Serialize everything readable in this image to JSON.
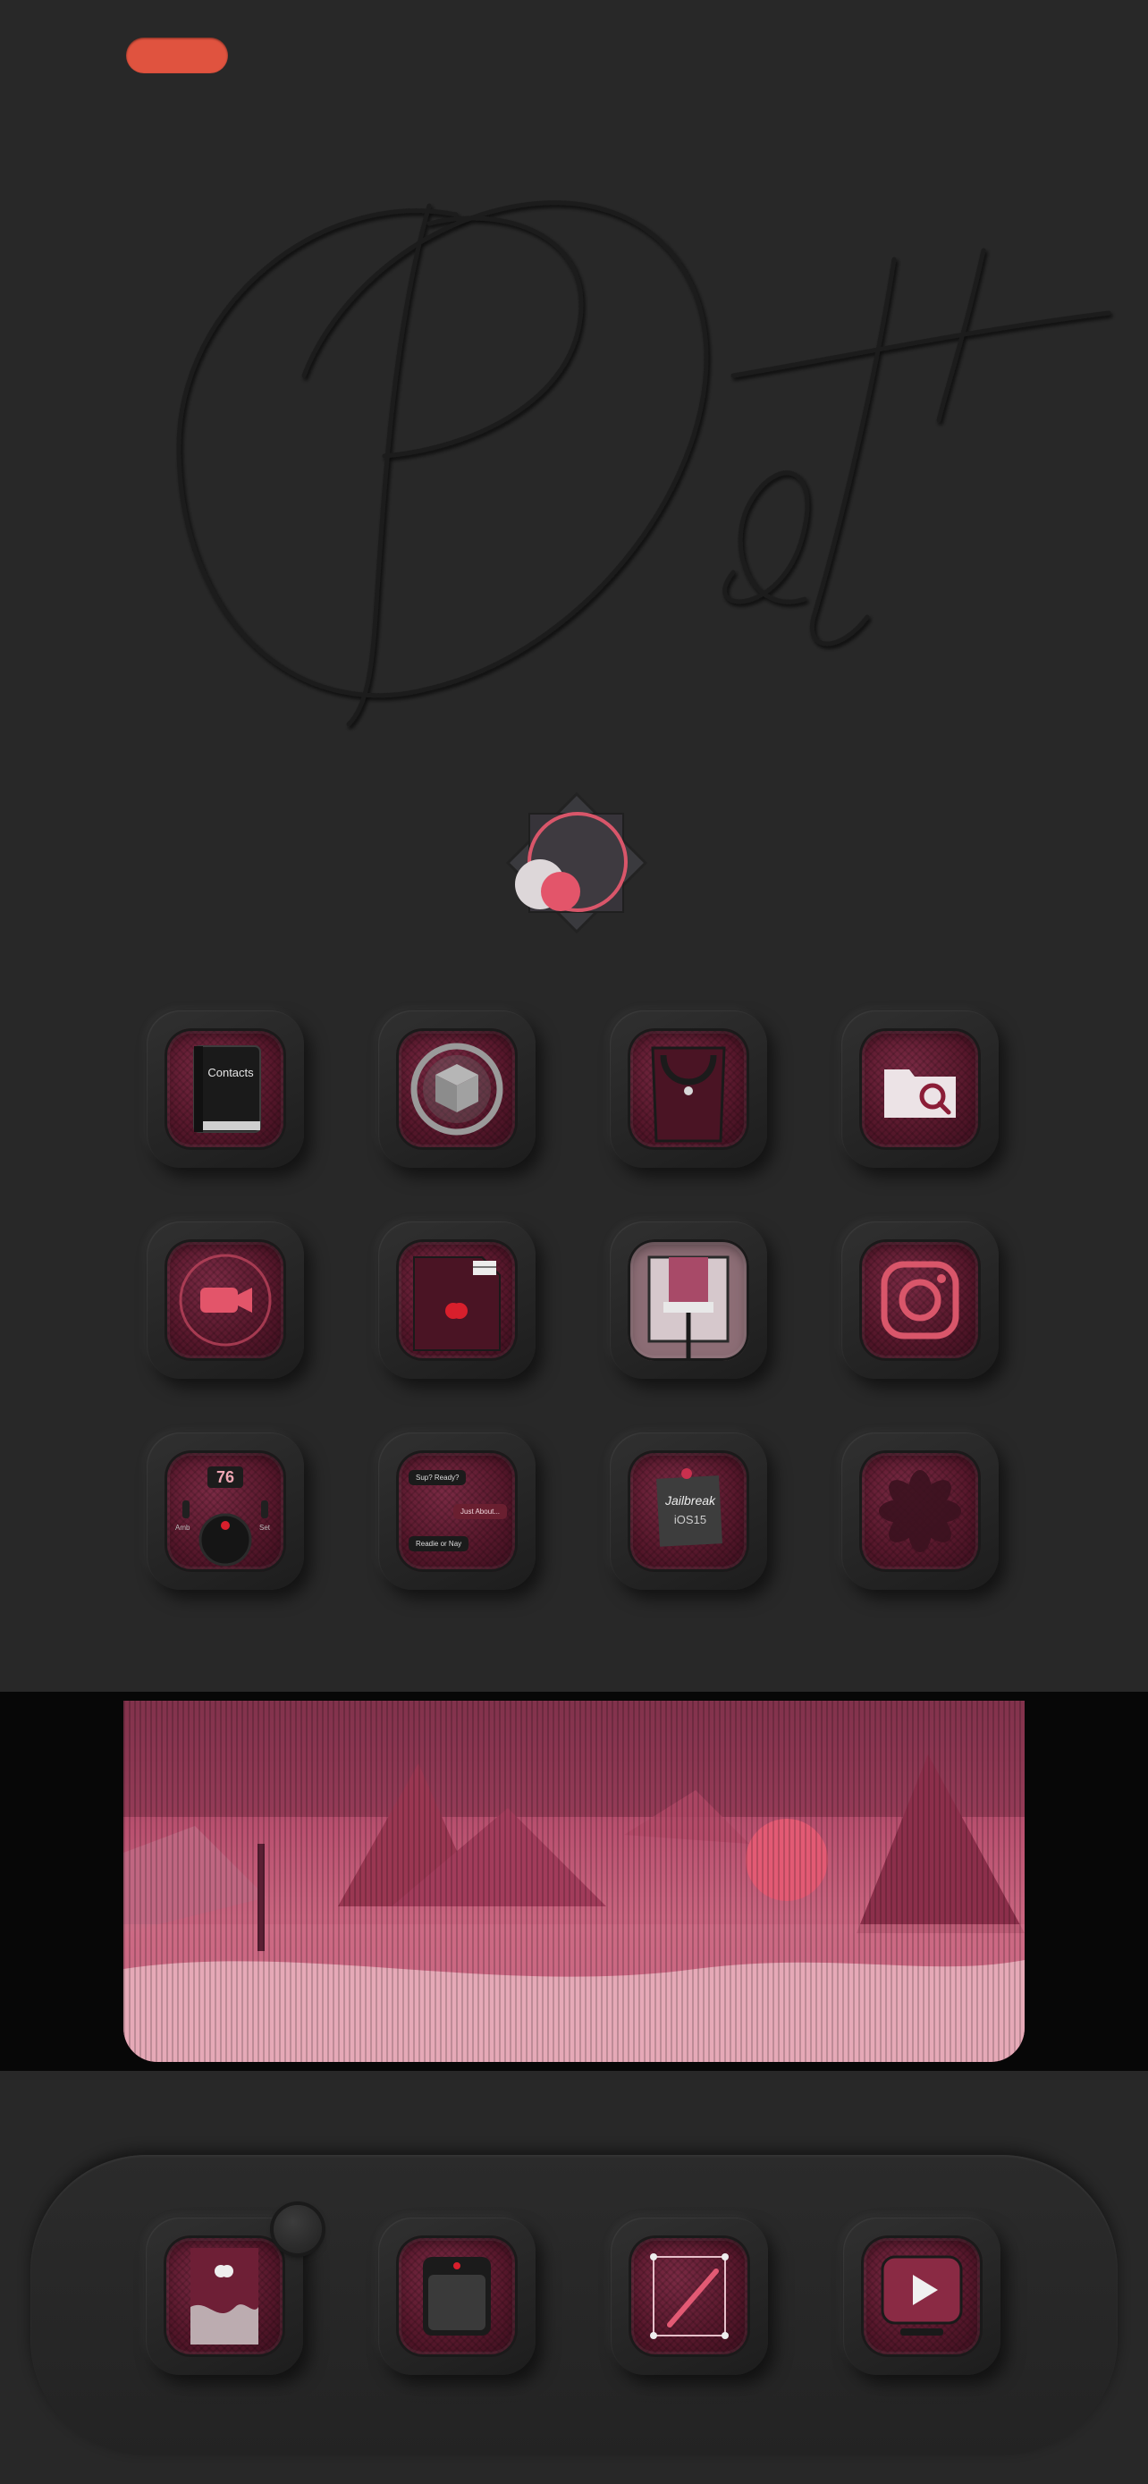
{
  "status": {
    "pill_color": "#e0533f"
  },
  "header": {
    "script_text": "Oct"
  },
  "colors": {
    "background": "#282828",
    "accent": "#e0533f",
    "icon_maroon": "#5c1a30",
    "banner_pink": "#c24a6c"
  },
  "grid": {
    "rows": [
      [
        {
          "name": "contacts",
          "icon": "contacts-book-icon",
          "label": "Contacts"
        },
        {
          "name": "cydia",
          "icon": "cydia-box-icon",
          "label": ""
        },
        {
          "name": "app-store",
          "icon": "shopping-bag-icon",
          "label": ""
        },
        {
          "name": "files",
          "icon": "folder-search-icon",
          "label": ""
        }
      ],
      [
        {
          "name": "facetime",
          "icon": "video-camera-icon",
          "label": ""
        },
        {
          "name": "sd-card",
          "icon": "sd-card-apple-icon",
          "label": ""
        },
        {
          "name": "paint",
          "icon": "paint-roller-icon",
          "label": ""
        },
        {
          "name": "instagram",
          "icon": "instagram-camera-icon",
          "label": ""
        }
      ],
      [
        {
          "name": "weather",
          "icon": "weather-dial-icon",
          "label": "76"
        },
        {
          "name": "messages",
          "icon": "chat-bubbles-icon",
          "label": ""
        },
        {
          "name": "notes",
          "icon": "sticky-note-icon",
          "label": "Jailbreak iOS15"
        },
        {
          "name": "photos",
          "icon": "flower-icon",
          "label": ""
        }
      ]
    ],
    "messages": {
      "bubble1": "Sup? Ready?",
      "bubble2": "Just About...",
      "bubble3": "Readie or Nay"
    },
    "weather": {
      "temp": "76",
      "left_label": "Amb",
      "right_label": "Set"
    },
    "notes": {
      "line1": "Jailbreak",
      "line2": "iOS15"
    },
    "contacts": {
      "label": "Contacts"
    }
  },
  "dock": {
    "apps": [
      {
        "name": "settings",
        "icon": "apple-drip-icon"
      },
      {
        "name": "phone",
        "icon": "device-icon"
      },
      {
        "name": "edit",
        "icon": "pen-select-icon"
      },
      {
        "name": "video",
        "icon": "play-button-icon"
      }
    ]
  }
}
